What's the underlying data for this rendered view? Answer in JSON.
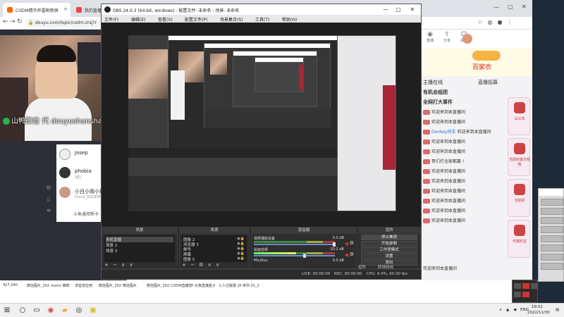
{
  "browser": {
    "tabs": [
      {
        "label": "CODM精华炸雷刷新屏"
      },
      {
        "label": "我的直播"
      }
    ],
    "address": "douyu.com/topic/codm-zrsj?r",
    "nav": {
      "back": "←",
      "forward": "→",
      "reload": "↻"
    }
  },
  "douyu": {
    "overlay_text": "山鸭微信 代 douyushanshanya",
    "chat_users": [
      {
        "name": "Josep",
        "sub": ""
      },
      {
        "name": "phobia",
        "sub": "[图]"
      },
      {
        "name": "小白小雨小猫",
        "sub": "Dunix_扣扣家族"
      }
    ],
    "list_link": "斗鱼通用帮卡",
    "right_tabs": [
      "直播",
      "分享",
      "关注"
    ],
    "promo": {
      "title": "百家衣"
    },
    "right_sections": [
      "主播在线",
      "直播招募"
    ],
    "messages": [
      {
        "text": "有机会组团",
        "big": true
      },
      {
        "text": "全网打大事件",
        "big": true
      },
      {
        "user": "",
        "text": "欢迎来到本直播间"
      },
      {
        "user": "",
        "text": "欢迎来到本直播间"
      },
      {
        "user": "Donkey快车",
        "text": "欢迎来到本直播间"
      },
      {
        "user": "",
        "text": "欢迎来到本直播间"
      },
      {
        "user": "",
        "text": "欢迎来到本直播间"
      },
      {
        "user": "",
        "text": "哥们打全家都赢 !"
      },
      {
        "user": "",
        "text": "欢迎来到本直播间"
      },
      {
        "user": "",
        "text": "欢迎来到本直播间"
      },
      {
        "user": "",
        "text": "欢迎来到本直播间"
      },
      {
        "user": "",
        "text": "欢迎来到本直播间"
      },
      {
        "user": "",
        "text": "欢迎来到本直播间"
      },
      {
        "user": "",
        "text": "欢迎来到本直播间"
      }
    ],
    "gifts": [
      {
        "label": "山公鸡"
      },
      {
        "label": "当前的首次抢购"
      },
      {
        "label": "当前的"
      },
      {
        "label": "可拖钓宝"
      }
    ],
    "status_line": "欢迎来到本直播间",
    "bottom_items": [
      "427-240",
      "微信图片_20221111...",
      "msmc 推荐",
      "求鉴定应用",
      "微信图片_2022021...",
      "微信图片",
      "微信图片_2022080...",
      "CODM直播管理-用...",
      "头像直播盒子 实况-...",
      "三人仕版报 26实战解读",
      "序列 01_2"
    ]
  },
  "obs": {
    "title": "OBS 24.0.3 (64-bit, windows) - 配置文件: 未命名 - 场景: 未命名",
    "win_controls": [
      "—",
      "▢",
      "✕"
    ],
    "menu": [
      "文件(F)",
      "编辑(E)",
      "查看(V)",
      "配置文件(P)",
      "场景集合(S)",
      "工具(T)",
      "帮助(H)"
    ],
    "docks": {
      "scenes": {
        "title": "场景",
        "items": [
          "多机直播",
          "场景 2",
          "场景 3"
        ],
        "tools": "+ − ∧ ∨"
      },
      "sources": {
        "title": "来源",
        "items": [
          "图像 2",
          "浏览器 3",
          "群号",
          "屏幕",
          "图像 5"
        ],
        "tools": "+ − ⚙ ∧ ∨"
      },
      "mixer": {
        "title": "混音器",
        "rows": [
          {
            "label": "视频捕获设备",
            "db": "0.0 dB"
          },
          {
            "label": "桌面音频",
            "db": "-10.2 dB"
          },
          {
            "label": "Mic/Aux",
            "db": "0.0 dB"
          }
        ]
      },
      "controls": {
        "title": "控件",
        "buttons": [
          "停止推流",
          "开始录制",
          "工作室模式",
          "设置",
          "退出"
        ],
        "footer": [
          "控件",
          "转场特效"
        ]
      }
    },
    "status": {
      "live": "LIVE: 00:00:00",
      "rec": "REC: 00:00:00",
      "cpu": "CPU: 4.4%, 60.00 fps"
    }
  },
  "taskbar": {
    "time": "19:01",
    "date": "2022/11/30",
    "lang": "ENG"
  }
}
